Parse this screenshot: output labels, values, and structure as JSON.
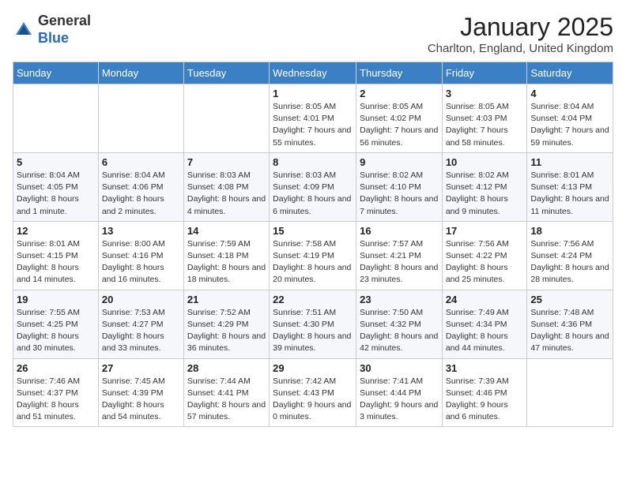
{
  "header": {
    "logo_general": "General",
    "logo_blue": "Blue",
    "month_title": "January 2025",
    "location": "Charlton, England, United Kingdom"
  },
  "days_of_week": [
    "Sunday",
    "Monday",
    "Tuesday",
    "Wednesday",
    "Thursday",
    "Friday",
    "Saturday"
  ],
  "weeks": [
    [
      {
        "day": "",
        "info": ""
      },
      {
        "day": "",
        "info": ""
      },
      {
        "day": "",
        "info": ""
      },
      {
        "day": "1",
        "info": "Sunrise: 8:05 AM\nSunset: 4:01 PM\nDaylight: 7 hours and 55 minutes."
      },
      {
        "day": "2",
        "info": "Sunrise: 8:05 AM\nSunset: 4:02 PM\nDaylight: 7 hours and 56 minutes."
      },
      {
        "day": "3",
        "info": "Sunrise: 8:05 AM\nSunset: 4:03 PM\nDaylight: 7 hours and 58 minutes."
      },
      {
        "day": "4",
        "info": "Sunrise: 8:04 AM\nSunset: 4:04 PM\nDaylight: 7 hours and 59 minutes."
      }
    ],
    [
      {
        "day": "5",
        "info": "Sunrise: 8:04 AM\nSunset: 4:05 PM\nDaylight: 8 hours and 1 minute."
      },
      {
        "day": "6",
        "info": "Sunrise: 8:04 AM\nSunset: 4:06 PM\nDaylight: 8 hours and 2 minutes."
      },
      {
        "day": "7",
        "info": "Sunrise: 8:03 AM\nSunset: 4:08 PM\nDaylight: 8 hours and 4 minutes."
      },
      {
        "day": "8",
        "info": "Sunrise: 8:03 AM\nSunset: 4:09 PM\nDaylight: 8 hours and 6 minutes."
      },
      {
        "day": "9",
        "info": "Sunrise: 8:02 AM\nSunset: 4:10 PM\nDaylight: 8 hours and 7 minutes."
      },
      {
        "day": "10",
        "info": "Sunrise: 8:02 AM\nSunset: 4:12 PM\nDaylight: 8 hours and 9 minutes."
      },
      {
        "day": "11",
        "info": "Sunrise: 8:01 AM\nSunset: 4:13 PM\nDaylight: 8 hours and 11 minutes."
      }
    ],
    [
      {
        "day": "12",
        "info": "Sunrise: 8:01 AM\nSunset: 4:15 PM\nDaylight: 8 hours and 14 minutes."
      },
      {
        "day": "13",
        "info": "Sunrise: 8:00 AM\nSunset: 4:16 PM\nDaylight: 8 hours and 16 minutes."
      },
      {
        "day": "14",
        "info": "Sunrise: 7:59 AM\nSunset: 4:18 PM\nDaylight: 8 hours and 18 minutes."
      },
      {
        "day": "15",
        "info": "Sunrise: 7:58 AM\nSunset: 4:19 PM\nDaylight: 8 hours and 20 minutes."
      },
      {
        "day": "16",
        "info": "Sunrise: 7:57 AM\nSunset: 4:21 PM\nDaylight: 8 hours and 23 minutes."
      },
      {
        "day": "17",
        "info": "Sunrise: 7:56 AM\nSunset: 4:22 PM\nDaylight: 8 hours and 25 minutes."
      },
      {
        "day": "18",
        "info": "Sunrise: 7:56 AM\nSunset: 4:24 PM\nDaylight: 8 hours and 28 minutes."
      }
    ],
    [
      {
        "day": "19",
        "info": "Sunrise: 7:55 AM\nSunset: 4:25 PM\nDaylight: 8 hours and 30 minutes."
      },
      {
        "day": "20",
        "info": "Sunrise: 7:53 AM\nSunset: 4:27 PM\nDaylight: 8 hours and 33 minutes."
      },
      {
        "day": "21",
        "info": "Sunrise: 7:52 AM\nSunset: 4:29 PM\nDaylight: 8 hours and 36 minutes."
      },
      {
        "day": "22",
        "info": "Sunrise: 7:51 AM\nSunset: 4:30 PM\nDaylight: 8 hours and 39 minutes."
      },
      {
        "day": "23",
        "info": "Sunrise: 7:50 AM\nSunset: 4:32 PM\nDaylight: 8 hours and 42 minutes."
      },
      {
        "day": "24",
        "info": "Sunrise: 7:49 AM\nSunset: 4:34 PM\nDaylight: 8 hours and 44 minutes."
      },
      {
        "day": "25",
        "info": "Sunrise: 7:48 AM\nSunset: 4:36 PM\nDaylight: 8 hours and 47 minutes."
      }
    ],
    [
      {
        "day": "26",
        "info": "Sunrise: 7:46 AM\nSunset: 4:37 PM\nDaylight: 8 hours and 51 minutes."
      },
      {
        "day": "27",
        "info": "Sunrise: 7:45 AM\nSunset: 4:39 PM\nDaylight: 8 hours and 54 minutes."
      },
      {
        "day": "28",
        "info": "Sunrise: 7:44 AM\nSunset: 4:41 PM\nDaylight: 8 hours and 57 minutes."
      },
      {
        "day": "29",
        "info": "Sunrise: 7:42 AM\nSunset: 4:43 PM\nDaylight: 9 hours and 0 minutes."
      },
      {
        "day": "30",
        "info": "Sunrise: 7:41 AM\nSunset: 4:44 PM\nDaylight: 9 hours and 3 minutes."
      },
      {
        "day": "31",
        "info": "Sunrise: 7:39 AM\nSunset: 4:46 PM\nDaylight: 9 hours and 6 minutes."
      },
      {
        "day": "",
        "info": ""
      }
    ]
  ]
}
